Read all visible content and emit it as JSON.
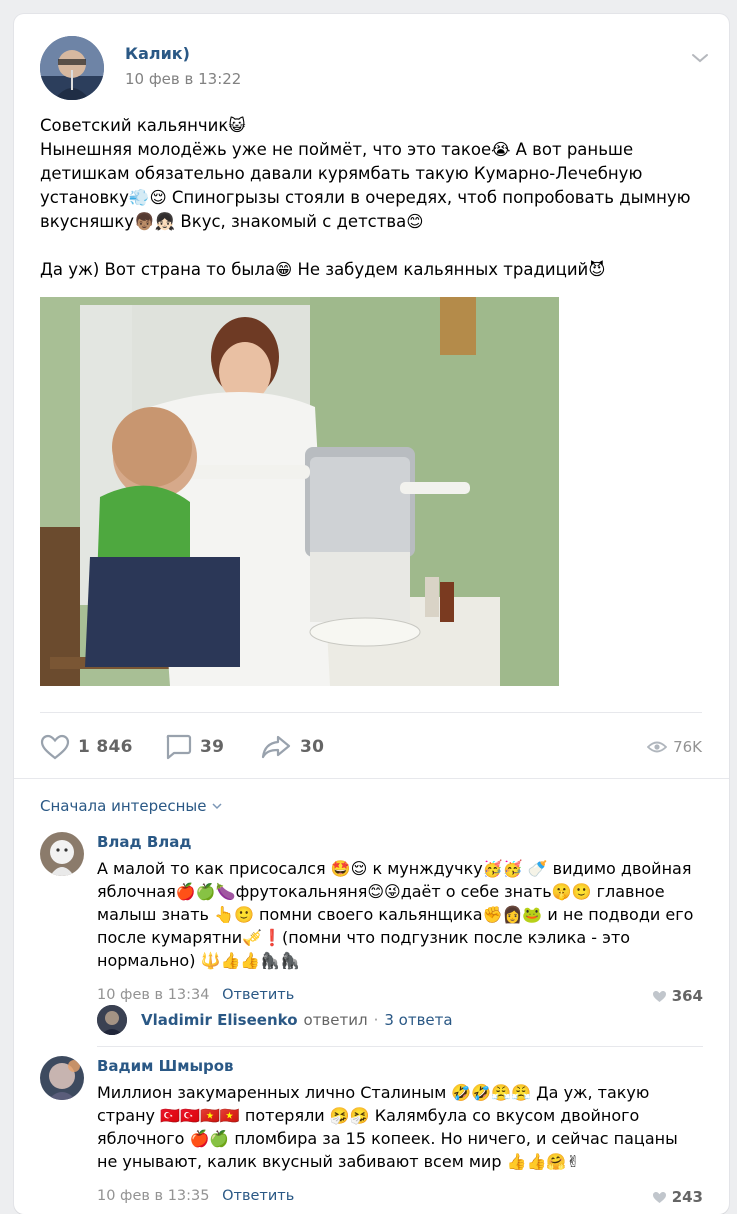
{
  "post": {
    "author": "Калик)",
    "date": "10 фев в 13:22",
    "text_lines": [
      "Советский кальянчик😺",
      "Нынешняя молодёжь уже не поймёт, что это такое😭 А вот раньше детишкам обязательно давали курямбать такую Кумарно-Лечебную установку💨😌 Спиногрызы стояли в очередях, чтоб попробовать дымную вкусняшку👦🏽👧🏻 Вкус, знакомый с детства😊",
      "Да уж) Вот страна то была😁 Не забудем кальянных традиций😈"
    ],
    "likes": "1 846",
    "comments": "39",
    "shares": "30",
    "views": "76K"
  },
  "sort_label": "Сначала интересные",
  "comments": [
    {
      "author": "Влад Влад",
      "text": "А малой то как присосался 🤩😌 к мунждучку🥳🥳 🍼 видимо двойная яблочная🍎🍏🍆фрутокальняня😊😜даёт о себе знать🤫🙂 главное малыш знать 👆🙂 помни своего кальянщика✊👩🐸 и не подводи его после кумарятни🎺❗(помни что подгузник после кэлика - это нормально) 🔱👍👍🦍🦍",
      "date": "10 фев в 13:34",
      "reply_label": "Ответить",
      "likes": "364",
      "replies": {
        "name": "Vladimir Eliseenko",
        "action": "ответил",
        "count": "3 ответа"
      }
    },
    {
      "author": "Вадим Шмыров",
      "text": "Миллион закумаренных лично Сталиным 🤣🤣😤😤 Да уж, такую страну 🇹🇷🇹🇷🇻🇳🇻🇳 потеряли 🤧🤧 Калямбула со вкусом двойного яблочного 🍎🍏 пломбира за 15 копеек. Но ничего, и сейчас пацаны не унывают, калик вкусный забивают всем мир 👍👍🤗✌",
      "date": "10 фев в 13:35",
      "reply_label": "Ответить",
      "likes": "243"
    }
  ],
  "colors": {
    "link": "#2a5885",
    "muted": "#939393",
    "background": "#edeef0"
  },
  "icons": [
    "chevron-down-icon",
    "heart-icon",
    "comment-icon",
    "share-icon",
    "eye-icon"
  ]
}
